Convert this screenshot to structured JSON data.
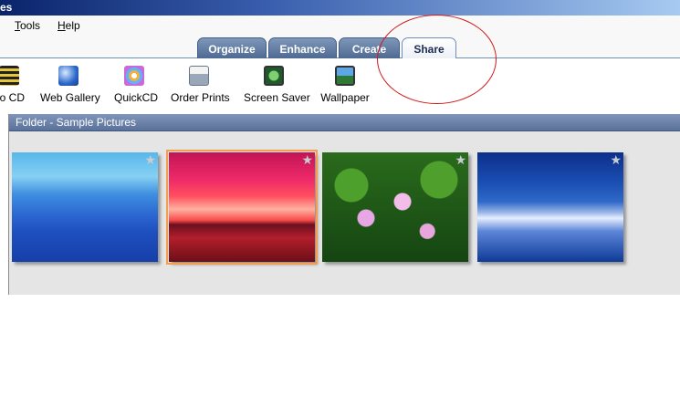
{
  "window": {
    "title": "es"
  },
  "menu": [
    {
      "label": "Tools",
      "mnemonic": "T",
      "rest": "ools"
    },
    {
      "label": "Help",
      "mnemonic": "H",
      "rest": "elp"
    }
  ],
  "tabs": [
    {
      "label": "Organize",
      "active": false
    },
    {
      "label": "Enhance",
      "active": false
    },
    {
      "label": "Create",
      "active": false
    },
    {
      "label": "Share",
      "active": true
    }
  ],
  "toolbar": [
    {
      "label": "eo CD",
      "icon": "video-cd-icon"
    },
    {
      "label": "Web Gallery",
      "icon": "web-gallery-icon"
    },
    {
      "label": "QuickCD",
      "icon": "quickcd-icon"
    },
    {
      "label": "Order Prints",
      "icon": "order-prints-icon"
    },
    {
      "label": "Screen Saver",
      "icon": "screen-saver-icon"
    },
    {
      "label": "Wallpaper",
      "icon": "wallpaper-icon"
    }
  ],
  "gallery": {
    "header": "Folder - Sample Pictures",
    "thumbnails": [
      {
        "subject": "Blue hills",
        "selected": false
      },
      {
        "subject": "Sunset",
        "selected": true
      },
      {
        "subject": "Water lilies",
        "selected": false
      },
      {
        "subject": "Winter",
        "selected": false
      }
    ]
  },
  "colors": {
    "selection": "#f0a050",
    "annotation_circle": "#d01818",
    "tab_active_text": "#1b2c50"
  }
}
